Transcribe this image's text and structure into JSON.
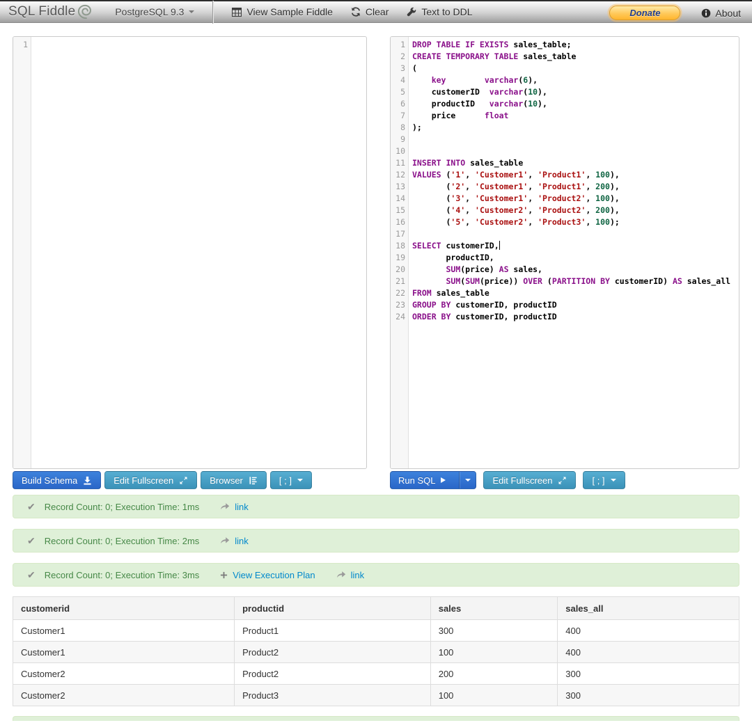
{
  "navbar": {
    "brand": "SQL Fiddle",
    "version_label": "PostgreSQL 9.3",
    "menu": {
      "view_sample": "View Sample Fiddle",
      "clear": "Clear",
      "text_to_ddl": "Text to DDL"
    },
    "donate_label": "Donate",
    "about_label": "About"
  },
  "schema_panel": {
    "line_numbers": [
      "1"
    ]
  },
  "query_panel": {
    "lines": [
      [
        [
          "k",
          "DROP TABLE IF EXISTS"
        ],
        [
          "d",
          " sales_table;"
        ]
      ],
      [
        [
          "k",
          "CREATE TEMPORARY TABLE"
        ],
        [
          "d",
          " sales_table"
        ]
      ],
      [
        [
          "d",
          "("
        ]
      ],
      [
        [
          "d",
          "    "
        ],
        [
          "k",
          "key"
        ],
        [
          "d",
          "        "
        ],
        [
          "k",
          "varchar"
        ],
        [
          "d",
          "("
        ],
        [
          "n",
          "6"
        ],
        [
          "d",
          "),"
        ]
      ],
      [
        [
          "d",
          "    customerID  "
        ],
        [
          "k",
          "varchar"
        ],
        [
          "d",
          "("
        ],
        [
          "n",
          "10"
        ],
        [
          "d",
          "),"
        ]
      ],
      [
        [
          "d",
          "    productID   "
        ],
        [
          "k",
          "varchar"
        ],
        [
          "d",
          "("
        ],
        [
          "n",
          "10"
        ],
        [
          "d",
          "),"
        ]
      ],
      [
        [
          "d",
          "    price      "
        ],
        [
          "k",
          "float"
        ]
      ],
      [
        [
          "d",
          ");"
        ]
      ],
      [],
      [],
      [
        [
          "k",
          "INSERT INTO"
        ],
        [
          "d",
          " sales_table"
        ]
      ],
      [
        [
          "k",
          "VALUES"
        ],
        [
          "d",
          " ("
        ],
        [
          "s",
          "'1'"
        ],
        [
          "d",
          ", "
        ],
        [
          "s",
          "'Customer1'"
        ],
        [
          "d",
          ", "
        ],
        [
          "s",
          "'Product1'"
        ],
        [
          "d",
          ", "
        ],
        [
          "n",
          "100"
        ],
        [
          "d",
          "),"
        ]
      ],
      [
        [
          "d",
          "       ("
        ],
        [
          "s",
          "'2'"
        ],
        [
          "d",
          ", "
        ],
        [
          "s",
          "'Customer1'"
        ],
        [
          "d",
          ", "
        ],
        [
          "s",
          "'Product1'"
        ],
        [
          "d",
          ", "
        ],
        [
          "n",
          "200"
        ],
        [
          "d",
          "),"
        ]
      ],
      [
        [
          "d",
          "       ("
        ],
        [
          "s",
          "'3'"
        ],
        [
          "d",
          ", "
        ],
        [
          "s",
          "'Customer1'"
        ],
        [
          "d",
          ", "
        ],
        [
          "s",
          "'Product2'"
        ],
        [
          "d",
          ", "
        ],
        [
          "n",
          "100"
        ],
        [
          "d",
          "),"
        ]
      ],
      [
        [
          "d",
          "       ("
        ],
        [
          "s",
          "'4'"
        ],
        [
          "d",
          ", "
        ],
        [
          "s",
          "'Customer2'"
        ],
        [
          "d",
          ", "
        ],
        [
          "s",
          "'Product2'"
        ],
        [
          "d",
          ", "
        ],
        [
          "n",
          "200"
        ],
        [
          "d",
          "),"
        ]
      ],
      [
        [
          "d",
          "       ("
        ],
        [
          "s",
          "'5'"
        ],
        [
          "d",
          ", "
        ],
        [
          "s",
          "'Customer2'"
        ],
        [
          "d",
          ", "
        ],
        [
          "s",
          "'Product3'"
        ],
        [
          "d",
          ", "
        ],
        [
          "n",
          "100"
        ],
        [
          "d",
          ");"
        ]
      ],
      [],
      [
        [
          "k",
          "SELECT"
        ],
        [
          "d",
          " customerID,"
        ],
        [
          "cursor",
          ""
        ]
      ],
      [
        [
          "d",
          "       productID,"
        ]
      ],
      [
        [
          "d",
          "       "
        ],
        [
          "k",
          "SUM"
        ],
        [
          "d",
          "(price) "
        ],
        [
          "k",
          "AS"
        ],
        [
          "d",
          " sales,"
        ]
      ],
      [
        [
          "d",
          "       "
        ],
        [
          "k",
          "SUM"
        ],
        [
          "d",
          "("
        ],
        [
          "k",
          "SUM"
        ],
        [
          "d",
          "(price)) "
        ],
        [
          "k",
          "OVER"
        ],
        [
          "d",
          " ("
        ],
        [
          "k",
          "PARTITION BY"
        ],
        [
          "d",
          " customerID) "
        ],
        [
          "k",
          "AS"
        ],
        [
          "d",
          " sales_all"
        ]
      ],
      [
        [
          "k",
          "FROM"
        ],
        [
          "d",
          " sales_table"
        ]
      ],
      [
        [
          "k",
          "GROUP BY"
        ],
        [
          "d",
          " customerID, productID"
        ]
      ],
      [
        [
          "k",
          "ORDER BY"
        ],
        [
          "d",
          " customerID, productID"
        ]
      ]
    ]
  },
  "toolbar_left": {
    "build_schema": "Build Schema",
    "edit_fullscreen": "Edit Fullscreen",
    "browser": "Browser",
    "terminator": "[ ; ]"
  },
  "toolbar_right": {
    "run_sql": "Run SQL",
    "edit_fullscreen": "Edit Fullscreen",
    "terminator": "[ ; ]"
  },
  "alerts": [
    {
      "message": "Record Count: 0; Execution Time: 1ms",
      "link_label": "link"
    },
    {
      "message": "Record Count: 0; Execution Time: 2ms",
      "link_label": "link"
    },
    {
      "message": "Record Count: 0; Execution Time: 3ms",
      "plan_label": "View Execution Plan",
      "link_label": "link"
    }
  ],
  "result_table": {
    "headers": [
      "customerid",
      "productid",
      "sales",
      "sales_all"
    ],
    "rows": [
      [
        "Customer1",
        "Product1",
        "300",
        "400"
      ],
      [
        "Customer1",
        "Product2",
        "100",
        "400"
      ],
      [
        "Customer2",
        "Product2",
        "200",
        "300"
      ],
      [
        "Customer2",
        "Product3",
        "100",
        "300"
      ]
    ]
  },
  "colors": {
    "keyword": "#8a108a",
    "string": "#aa1111",
    "number": "#116644",
    "alert_bg": "#dff0d8",
    "alert_text": "#468847",
    "link": "#0088cc",
    "btn_primary": "#2f6fd0",
    "btn_info": "#4aa3c8"
  }
}
